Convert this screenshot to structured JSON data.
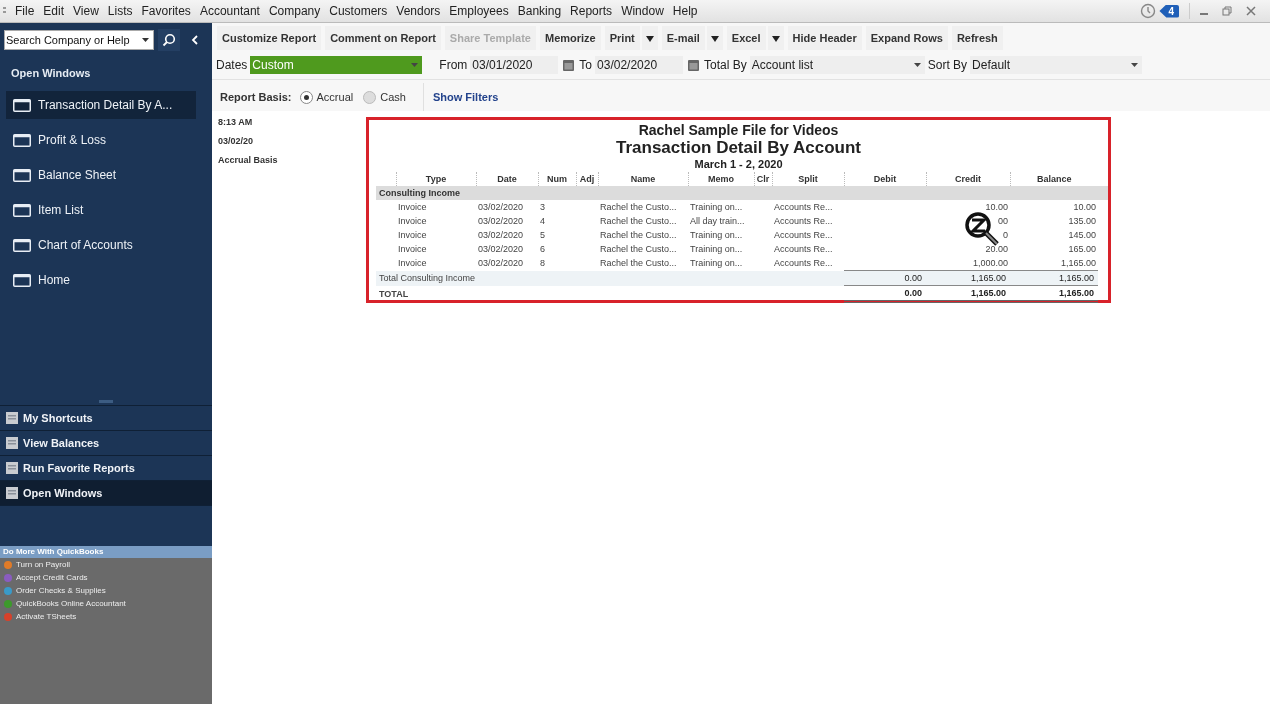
{
  "menu": [
    "File",
    "Edit",
    "View",
    "Lists",
    "Favorites",
    "Accountant",
    "Company",
    "Customers",
    "Vendors",
    "Employees",
    "Banking",
    "Reports",
    "Window",
    "Help"
  ],
  "reminders": {
    "count": "4"
  },
  "sidebar": {
    "search": {
      "placeholder": "Search Company or Help"
    },
    "open_windows_title": "Open Windows",
    "open_windows": [
      {
        "label": "Transaction Detail By A...",
        "selected": true
      },
      {
        "label": "Profit & Loss",
        "selected": false
      },
      {
        "label": "Balance Sheet",
        "selected": false
      },
      {
        "label": "Item List",
        "selected": false
      },
      {
        "label": "Chart of Accounts",
        "selected": false
      },
      {
        "label": "Home",
        "selected": false
      }
    ],
    "nav": [
      {
        "label": "My Shortcuts",
        "selected": false
      },
      {
        "label": "View Balances",
        "selected": false
      },
      {
        "label": "Run Favorite Reports",
        "selected": false
      },
      {
        "label": "Open Windows",
        "selected": true
      }
    ],
    "promo": {
      "title": "Do More With QuickBooks",
      "items": [
        {
          "label": "Turn on Payroll",
          "color": "#e07b28"
        },
        {
          "label": "Accept Credit Cards",
          "color": "#8a5cc0"
        },
        {
          "label": "Order Checks & Supplies",
          "color": "#3a9ac8"
        },
        {
          "label": "QuickBooks Online Accountant",
          "color": "#3d9a2c"
        },
        {
          "label": "Activate TSheets",
          "color": "#d8412a"
        }
      ]
    }
  },
  "toolbar": [
    {
      "label": "Customize Report",
      "disabled": false,
      "dropdown": false
    },
    {
      "label": "Comment on Report",
      "disabled": false,
      "dropdown": false
    },
    {
      "label": "Share Template",
      "disabled": true,
      "dropdown": false
    },
    {
      "label": "Memorize",
      "disabled": false,
      "dropdown": false
    },
    {
      "label": "Print",
      "disabled": false,
      "dropdown": true
    },
    {
      "label": "E-mail",
      "disabled": false,
      "dropdown": true
    },
    {
      "label": "Excel",
      "disabled": false,
      "dropdown": true
    },
    {
      "label": "Hide Header",
      "disabled": false,
      "dropdown": false
    },
    {
      "label": "Expand Rows",
      "disabled": false,
      "dropdown": false
    },
    {
      "label": "Refresh",
      "disabled": false,
      "dropdown": false
    }
  ],
  "filters": {
    "dates_label": "Dates",
    "dates": "Custom",
    "from_label": "From",
    "from": "03/01/2020",
    "to_label": "To",
    "to": "03/02/2020",
    "total_by_label": "Total By",
    "total_by": "Account list",
    "sort_by_label": "Sort By",
    "sort_by": "Default"
  },
  "basis": {
    "label": "Report Basis:",
    "options": [
      {
        "label": "Accrual",
        "selected": true
      },
      {
        "label": "Cash",
        "selected": false
      }
    ],
    "show_filters": "Show Filters"
  },
  "report": {
    "time": "8:13 AM",
    "date": "03/02/20",
    "basis": "Accrual Basis",
    "company": "Rachel Sample File for Videos",
    "title": "Transaction Detail By Account",
    "date_range": "March 1 - 2, 2020",
    "columns": [
      "Type",
      "Date",
      "Num",
      "Adj",
      "Name",
      "Memo",
      "Clr",
      "Split",
      "Debit",
      "Credit",
      "Balance"
    ],
    "section": "Consulting Income",
    "rows": [
      [
        "Invoice",
        "03/02/2020",
        "3",
        "",
        "Rachel the Custo...",
        "Training on...",
        "",
        "Accounts Re...",
        "",
        "10.00",
        "10.00"
      ],
      [
        "Invoice",
        "03/02/2020",
        "4",
        "",
        "Rachel the Custo...",
        "All day train...",
        "",
        "Accounts Re...",
        "",
        "00",
        "135.00"
      ],
      [
        "Invoice",
        "03/02/2020",
        "5",
        "",
        "Rachel the Custo...",
        "Training on...",
        "",
        "Accounts Re...",
        "",
        "0",
        "145.00"
      ],
      [
        "Invoice",
        "03/02/2020",
        "6",
        "",
        "Rachel the Custo...",
        "Training on...",
        "",
        "Accounts Re...",
        "",
        "20.00",
        "165.00"
      ],
      [
        "Invoice",
        "03/02/2020",
        "8",
        "",
        "Rachel the Custo...",
        "Training on...",
        "",
        "Accounts Re...",
        "",
        "1,000.00",
        "1,165.00"
      ]
    ],
    "section_total": {
      "label": "Total Consulting Income",
      "debit": "0.00",
      "credit": "1,165.00",
      "balance": "1,165.00"
    },
    "grand_total": {
      "label": "TOTAL",
      "debit": "0.00",
      "credit": "1,165.00",
      "balance": "1,165.00"
    }
  }
}
